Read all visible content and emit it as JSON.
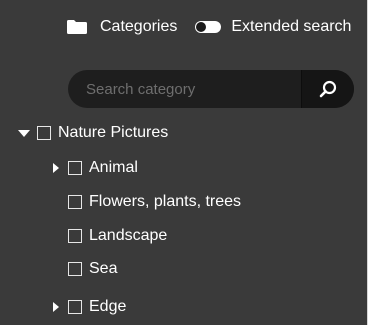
{
  "header": {
    "categories_label": "Categories",
    "extended_search_label": "Extended search",
    "folder_icon": "folder-icon",
    "toggle_icon": "toggle-off-icon"
  },
  "search": {
    "placeholder": "Search category",
    "value": "",
    "button_icon": "search-icon"
  },
  "tree": [
    {
      "label": "Nature Pictures",
      "expander": "expanded",
      "checked": false
    },
    {
      "label": "Animal",
      "expander": "collapsed",
      "checked": false
    },
    {
      "label": "Flowers, plants, trees",
      "expander": "none",
      "checked": false
    },
    {
      "label": "Landscape",
      "expander": "none",
      "checked": false
    },
    {
      "label": "Sea",
      "expander": "none",
      "checked": false
    },
    {
      "label": "Edge",
      "expander": "collapsed",
      "checked": false
    }
  ],
  "colors": {
    "panel_background": "#3a3a3a",
    "search_background": "#1e1e1e",
    "search_button_background": "#151515",
    "text": "#ffffff",
    "placeholder": "#6e6e6e"
  }
}
